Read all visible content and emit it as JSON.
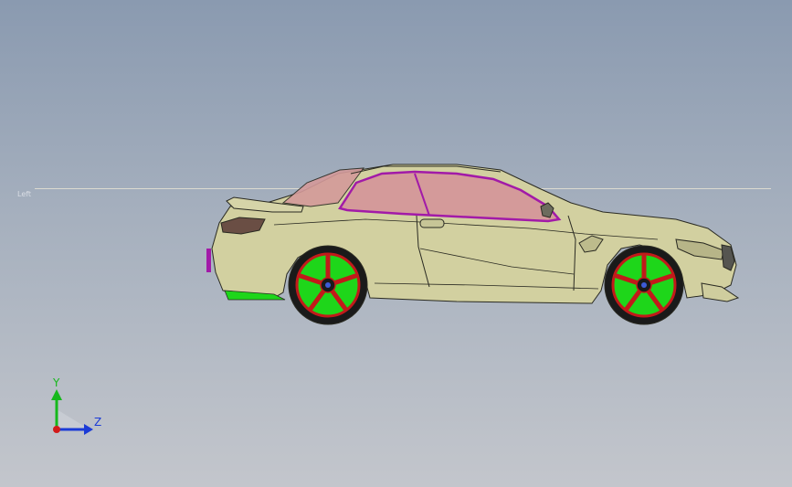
{
  "viewport": {
    "background_top": "#8a9ab0",
    "background_bottom": "#c3c6cc"
  },
  "reference_plane": {
    "label": "Left",
    "line_color": "#e6e2d4"
  },
  "model": {
    "body_color": "#d2d0a0",
    "glass_color": "#d49a9a",
    "trim_color": "#a21aa8",
    "wheel_color": "#1ed61a",
    "rim_color": "#c21a1a",
    "taillight_color": "#6a4e44"
  },
  "triad": {
    "y_label": "Y",
    "z_label": "Z",
    "y_color": "#16b81c",
    "z_color": "#1b3bd6",
    "x_color": "#d21a1a",
    "icon": "axis-triad-icon"
  }
}
